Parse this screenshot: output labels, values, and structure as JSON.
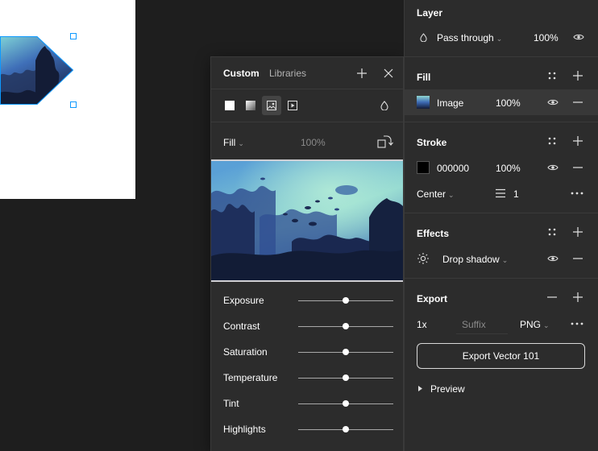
{
  "popover": {
    "tabs": [
      {
        "label": "Custom",
        "active": true
      },
      {
        "label": "Libraries",
        "active": false
      }
    ],
    "icons": {
      "add": "plus-icon",
      "close": "close-icon"
    },
    "fill_types": [
      "solid",
      "gradient",
      "image",
      "video",
      "blend"
    ],
    "active_fill_type": "image",
    "fill_label": "Fill",
    "opacity": "100%",
    "adjustments": [
      {
        "label": "Exposure",
        "value": 0.5
      },
      {
        "label": "Contrast",
        "value": 0.5
      },
      {
        "label": "Saturation",
        "value": 0.5
      },
      {
        "label": "Temperature",
        "value": 0.5
      },
      {
        "label": "Tint",
        "value": 0.5
      },
      {
        "label": "Highlights",
        "value": 0.5
      }
    ]
  },
  "panel": {
    "layer": {
      "title": "Layer",
      "blend_mode": "Pass through",
      "opacity": "100%"
    },
    "fill": {
      "title": "Fill",
      "type": "Image",
      "opacity": "100%"
    },
    "stroke": {
      "title": "Stroke",
      "color_hex": "000000",
      "opacity": "100%",
      "align": "Center",
      "weight": "1"
    },
    "effects": {
      "title": "Effects",
      "effect": "Drop shadow"
    },
    "export": {
      "title": "Export",
      "scale": "1x",
      "suffix_placeholder": "Suffix",
      "format": "PNG",
      "button_label": "Export Vector 101",
      "preview_label": "Preview"
    }
  },
  "colors": {
    "selection": "#0d99ff",
    "panel_bg": "#2c2c2c",
    "canvas_bg": "#1e1e1e"
  }
}
